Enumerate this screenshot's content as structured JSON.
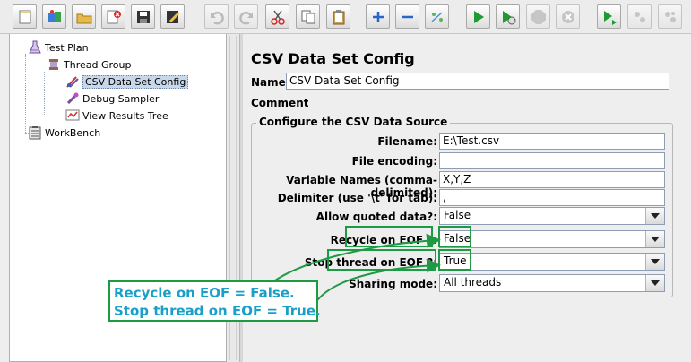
{
  "tree": {
    "items": [
      {
        "label": "Test Plan",
        "icon": "beaker-icon"
      },
      {
        "label": "Thread Group",
        "icon": "spool-icon"
      },
      {
        "label": "CSV Data Set Config",
        "icon": "csv-config-icon"
      },
      {
        "label": "Debug Sampler",
        "icon": "pipette-icon"
      },
      {
        "label": "View Results Tree",
        "icon": "results-tree-icon"
      },
      {
        "label": "WorkBench",
        "icon": "clipboard-icon"
      }
    ],
    "selected_index": 2
  },
  "panel": {
    "title": "CSV Data Set Config",
    "name_label": "Name:",
    "name_value": "CSV Data Set Config",
    "comments_label": "Comments:",
    "group_title": "Configure the CSV Data Source",
    "fields": {
      "filename": {
        "label": "Filename:",
        "value": "E:\\Test.csv"
      },
      "encoding": {
        "label": "File encoding:",
        "value": ""
      },
      "variables": {
        "label": "Variable Names (comma-delimited):",
        "value": "X,Y,Z"
      },
      "delimiter": {
        "label": "Delimiter (use '\\t' for tab):",
        "value": ","
      }
    },
    "selects": {
      "quoted": {
        "label": "Allow quoted data?:",
        "value": "False"
      },
      "recycle": {
        "label": "Recycle on EOF ?:",
        "value": "False"
      },
      "stop": {
        "label": "Stop thread on EOF ?:",
        "value": "True"
      },
      "sharing": {
        "label": "Sharing mode:",
        "value": "All threads"
      }
    }
  },
  "annotation": {
    "line1": "Recycle on EOF = False.",
    "line2": "Stop thread on EOF = True."
  },
  "colors": {
    "highlight": "#1e9a44",
    "annotation_text": "#1aa0c8",
    "selection": "#c8d8ea"
  }
}
